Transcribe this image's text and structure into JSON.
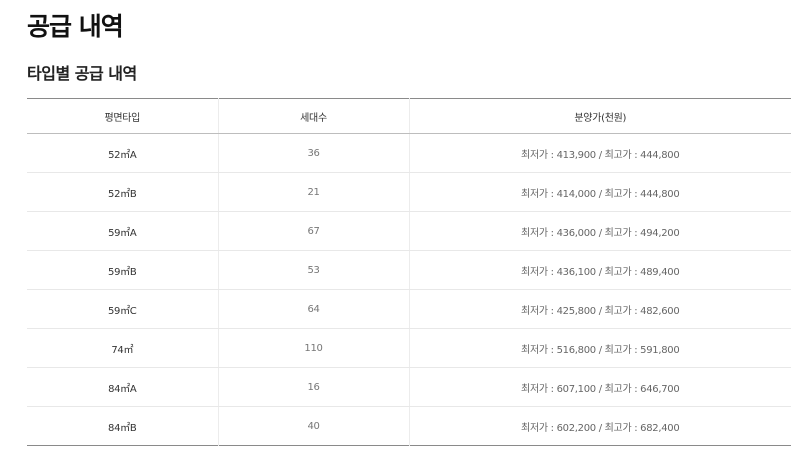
{
  "page": {
    "title": "공급 내역",
    "section_title": "타입별 공급 내역"
  },
  "table": {
    "headers": [
      "평면타입",
      "세대수",
      "분양가(천원)"
    ],
    "rows": [
      {
        "type": "52㎡A",
        "units": "36",
        "price": "최저가 : 413,900 / 최고가 : 444,800"
      },
      {
        "type": "52㎡B",
        "units": "21",
        "price": "최저가 : 414,000 / 최고가 : 444,800"
      },
      {
        "type": "59㎡A",
        "units": "67",
        "price": "최저가 : 436,000 / 최고가 :  494,200"
      },
      {
        "type": "59㎡B",
        "units": "53",
        "price": "최저가 : 436,100 / 최고가 : 489,400"
      },
      {
        "type": "59㎡C",
        "units": "64",
        "price": "최저가 : 425,800 / 최고가 : 482,600"
      },
      {
        "type": "74㎡",
        "units": "110",
        "price": "최저가 : 516,800 / 최고가 : 591,800"
      },
      {
        "type": "84㎡A",
        "units": "16",
        "price": "최저가 : 607,100 / 최고가 : 646,700"
      },
      {
        "type": "84㎡B",
        "units": "40",
        "price": "최저가 : 602,200 / 최고가 : 682,400"
      }
    ]
  }
}
